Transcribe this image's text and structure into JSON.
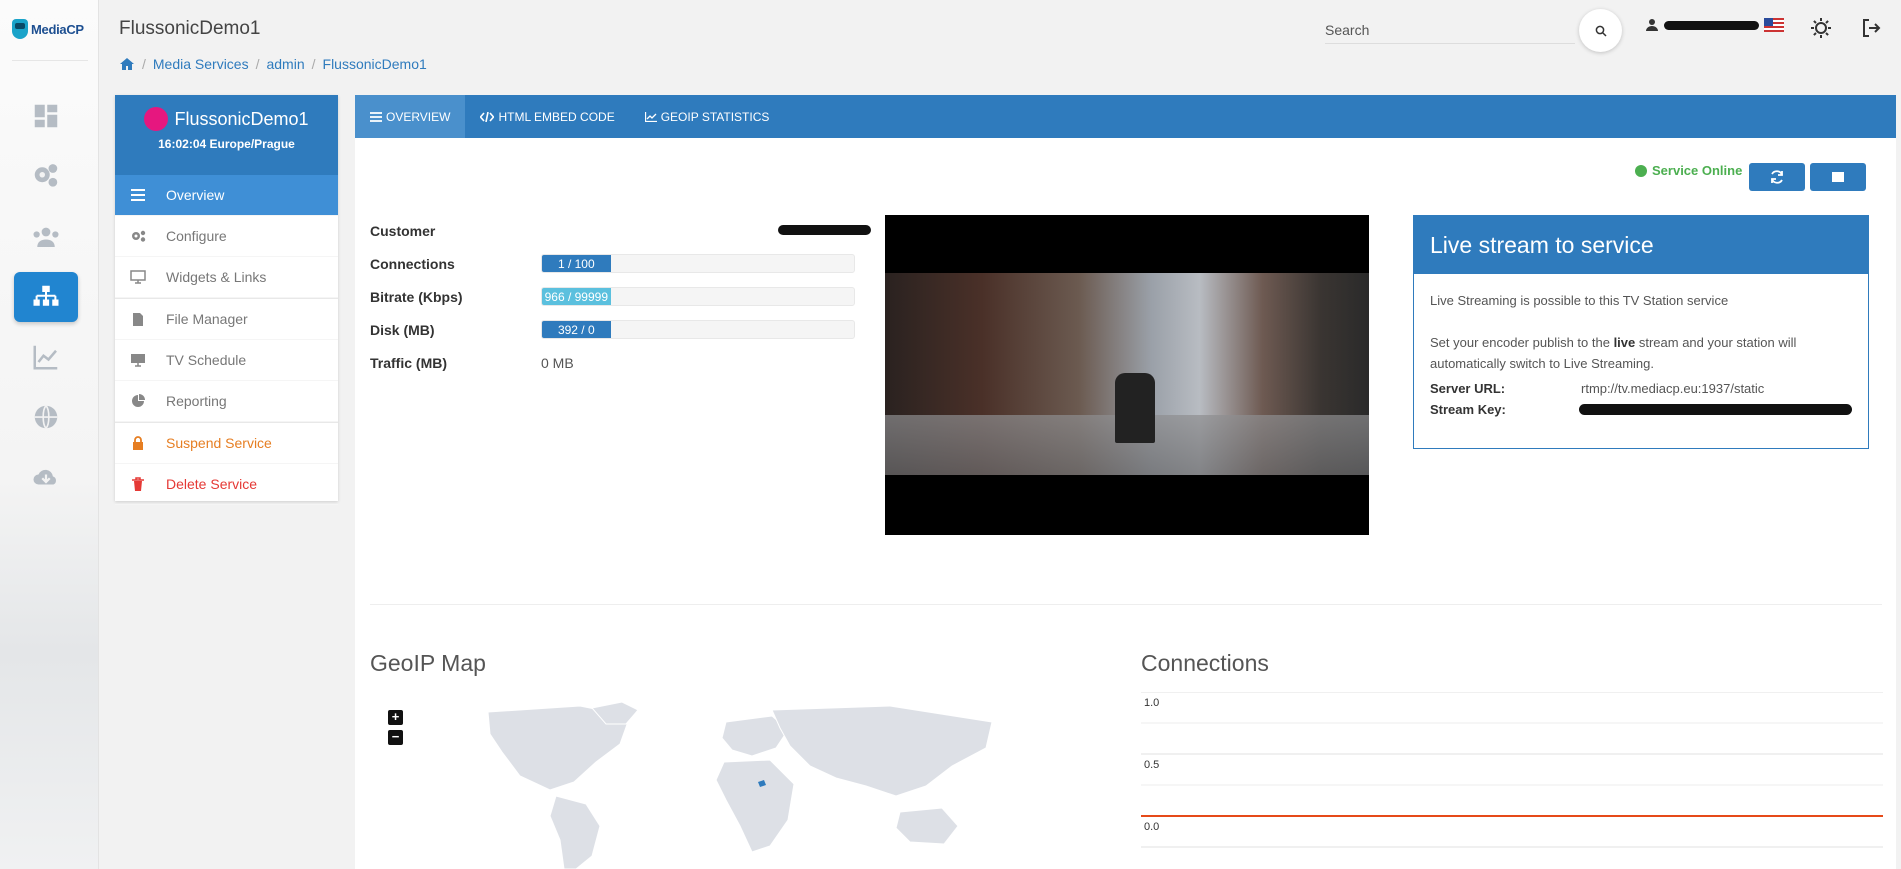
{
  "app": {
    "logo_text": "MediaCP",
    "title": "FlussonicDemo1"
  },
  "breadcrumb": [
    "Media Services",
    "admin",
    "FlussonicDemo1"
  ],
  "header": {
    "search_placeholder": "Search"
  },
  "rail": [
    {
      "name": "dashboard-icon",
      "active": false
    },
    {
      "name": "gears-icon",
      "active": false
    },
    {
      "name": "users-icon",
      "active": false
    },
    {
      "name": "sitemap-icon",
      "active": true
    },
    {
      "name": "chart-icon",
      "active": false
    },
    {
      "name": "globe-icon",
      "active": false
    },
    {
      "name": "cloud-download-icon",
      "active": false
    }
  ],
  "service": {
    "name": "FlussonicDemo1",
    "time": "16:02:04 Europe/Prague",
    "menu": [
      {
        "label": "Overview",
        "icon": "bars-icon",
        "state": "active"
      },
      {
        "label": "Configure",
        "icon": "gears-icon",
        "state": "normal"
      },
      {
        "label": "Widgets & Links",
        "icon": "monitor-icon",
        "state": "normal"
      },
      {
        "label": "File Manager",
        "icon": "file-icon",
        "state": "normal"
      },
      {
        "label": "TV Schedule",
        "icon": "desktop-icon",
        "state": "normal"
      },
      {
        "label": "Reporting",
        "icon": "pie-icon",
        "state": "normal"
      },
      {
        "label": "Suspend Service",
        "icon": "lock-icon",
        "state": "warn"
      },
      {
        "label": "Delete Service",
        "icon": "trash-icon",
        "state": "danger"
      }
    ]
  },
  "tabs": [
    {
      "label": "OVERVIEW",
      "icon": "bars-icon",
      "active": true
    },
    {
      "label": "HTML EMBED CODE",
      "icon": "code-icon",
      "active": false
    },
    {
      "label": "GEOIP STATISTICS",
      "icon": "chart-icon",
      "active": false
    }
  ],
  "status": {
    "label": "Service Online",
    "color": "#4caf50"
  },
  "stats": {
    "customer_label": "Customer",
    "connections_label": "Connections",
    "connections_value": "1 / 100",
    "connections_fraction": 0.01,
    "bitrate_label": "Bitrate (Kbps)",
    "bitrate_value": "966 / 99999",
    "bitrate_fraction": 0.0097,
    "disk_label": "Disk (MB)",
    "disk_value": "392 / 0",
    "traffic_label": "Traffic (MB)",
    "traffic_value": "0 MB"
  },
  "live": {
    "title": "Live stream to service",
    "line1": "Live Streaming is possible to this TV Station service",
    "line2_pre": "Set your encoder publish to the ",
    "line2_bold": "live",
    "line2_post": " stream and your station will automatically switch to Live Streaming.",
    "server_url_label": "Server URL:",
    "server_url": "rtmp://tv.mediacp.eu:1937/static",
    "stream_key_label": "Stream Key:"
  },
  "geoip": {
    "title": "GeoIP Map"
  },
  "connections_chart": {
    "title": "Connections"
  },
  "chart_data": {
    "type": "line",
    "title": "Connections",
    "yticks": [
      "1.0",
      "0.5",
      "0.0"
    ],
    "ylim": [
      0,
      1
    ],
    "series": [
      {
        "values": [
          0,
          0
        ]
      }
    ],
    "colors": {
      "line": "#e64a19",
      "grid": "#e0e0e0"
    }
  },
  "colors": {
    "accent": "#2f7bbd",
    "online": "#4caf50",
    "warn": "#e67e22",
    "danger": "#e53935"
  }
}
